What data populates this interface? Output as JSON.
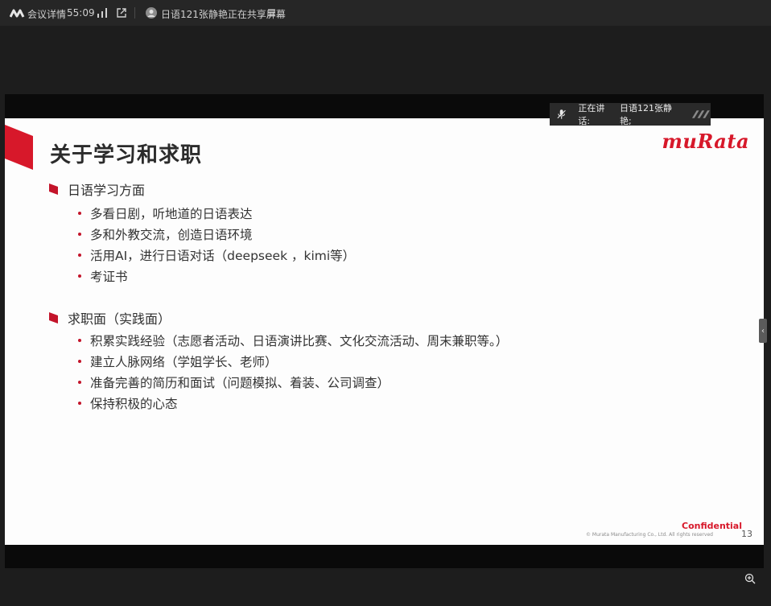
{
  "topbar": {
    "meeting_label": "会议详情",
    "timer": "55:09",
    "presenter_status": "日语121张静艳正在共享屏幕"
  },
  "speaking": {
    "label": "正在讲话:",
    "name": "日语121张静艳;"
  },
  "slide": {
    "title": "关于学习和求职",
    "brand": "muRata",
    "sections": [
      {
        "heading": "日语学习方面",
        "bullets": [
          "多看日剧，听地道的日语表达",
          "多和外教交流，创造日语环境",
          "活用AI，进行日语对话（deepseek ，kimi等）",
          "考证书"
        ]
      },
      {
        "heading": "求职面（实践面）",
        "bullets": [
          "积累实践经验（志愿者活动、日语演讲比赛、文化交流活动、周末兼职等。）",
          "建立人脉网络（学姐学长、老师）",
          "准备完善的简历和面试（问题模拟、着装、公司调查）",
          "保持积极的心态"
        ]
      }
    ],
    "confidential": "Confidential",
    "copyright": "© Murata Manufacturing Co., Ltd. All rights reserved",
    "page_number": "13"
  },
  "icons": {
    "logo": "app-logo-icon",
    "signal": "signal-bars-icon",
    "popout": "popout-icon",
    "avatar": "avatar-icon",
    "menu": "menu-icon",
    "mic": "mic-muted-icon",
    "zoom": "zoom-in-icon"
  },
  "colors": {
    "accent": "#d7182a",
    "topbar": "#262626",
    "stage": "#1d1d1d"
  }
}
